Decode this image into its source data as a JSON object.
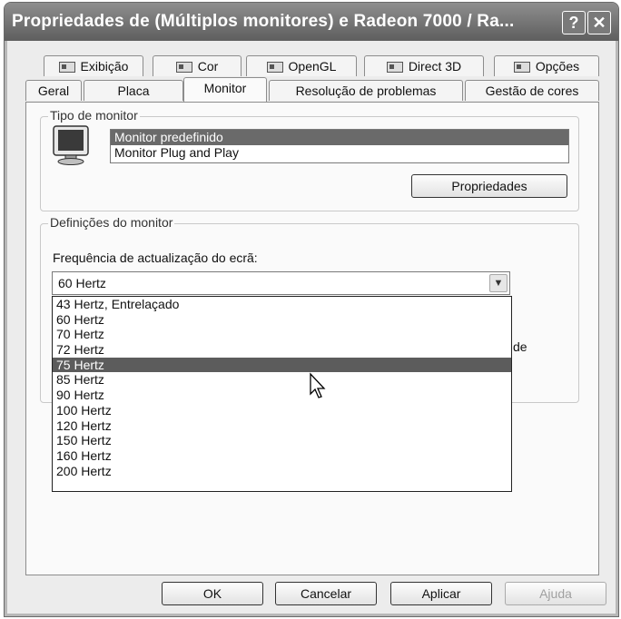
{
  "window": {
    "title": "Propriedades de (Múltiplos monitores) e Radeon 7000 / Ra...",
    "help_label": "?",
    "close_label": "✕"
  },
  "tabs_top": [
    {
      "label": "Exibição",
      "icon": "display-icon"
    },
    {
      "label": "Cor",
      "icon": "display-icon"
    },
    {
      "label": "OpenGL",
      "icon": "display-icon"
    },
    {
      "label": "Direct 3D",
      "icon": "display-icon"
    },
    {
      "label": "Opções",
      "icon": "display-icon"
    }
  ],
  "tabs_bottom": [
    {
      "label": "Geral"
    },
    {
      "label": "Placa"
    },
    {
      "label": "Monitor",
      "active": true
    },
    {
      "label": "Resolução de problemas"
    },
    {
      "label": "Gestão de cores"
    }
  ],
  "monitor_type": {
    "legend": "Tipo de monitor",
    "items": [
      "Monitor predefinido",
      "Monitor Plug and Play"
    ],
    "selected_index": 0,
    "properties_button": "Propriedades"
  },
  "monitor_settings": {
    "legend": "Definições do monitor",
    "refresh_label": "Frequência de actualização do ecrã:",
    "refresh_value": "60 Hertz",
    "options": [
      "43 Hertz, Entrelaçado",
      "60 Hertz",
      "70 Hertz",
      "72 Hertz",
      "75 Hertz",
      "85 Hertz",
      "90 Hertz",
      "100 Hertz",
      "120 Hertz",
      "150 Hertz",
      "160 Hertz",
      "200 Hertz"
    ],
    "highlighted_index": 4,
    "partial_text": "de"
  },
  "buttons": {
    "ok": "OK",
    "cancel": "Cancelar",
    "apply": "Aplicar",
    "help": "Ajuda"
  },
  "colors": {
    "titlebar": "#6e6e6e",
    "selection": "#5c5c5c"
  }
}
